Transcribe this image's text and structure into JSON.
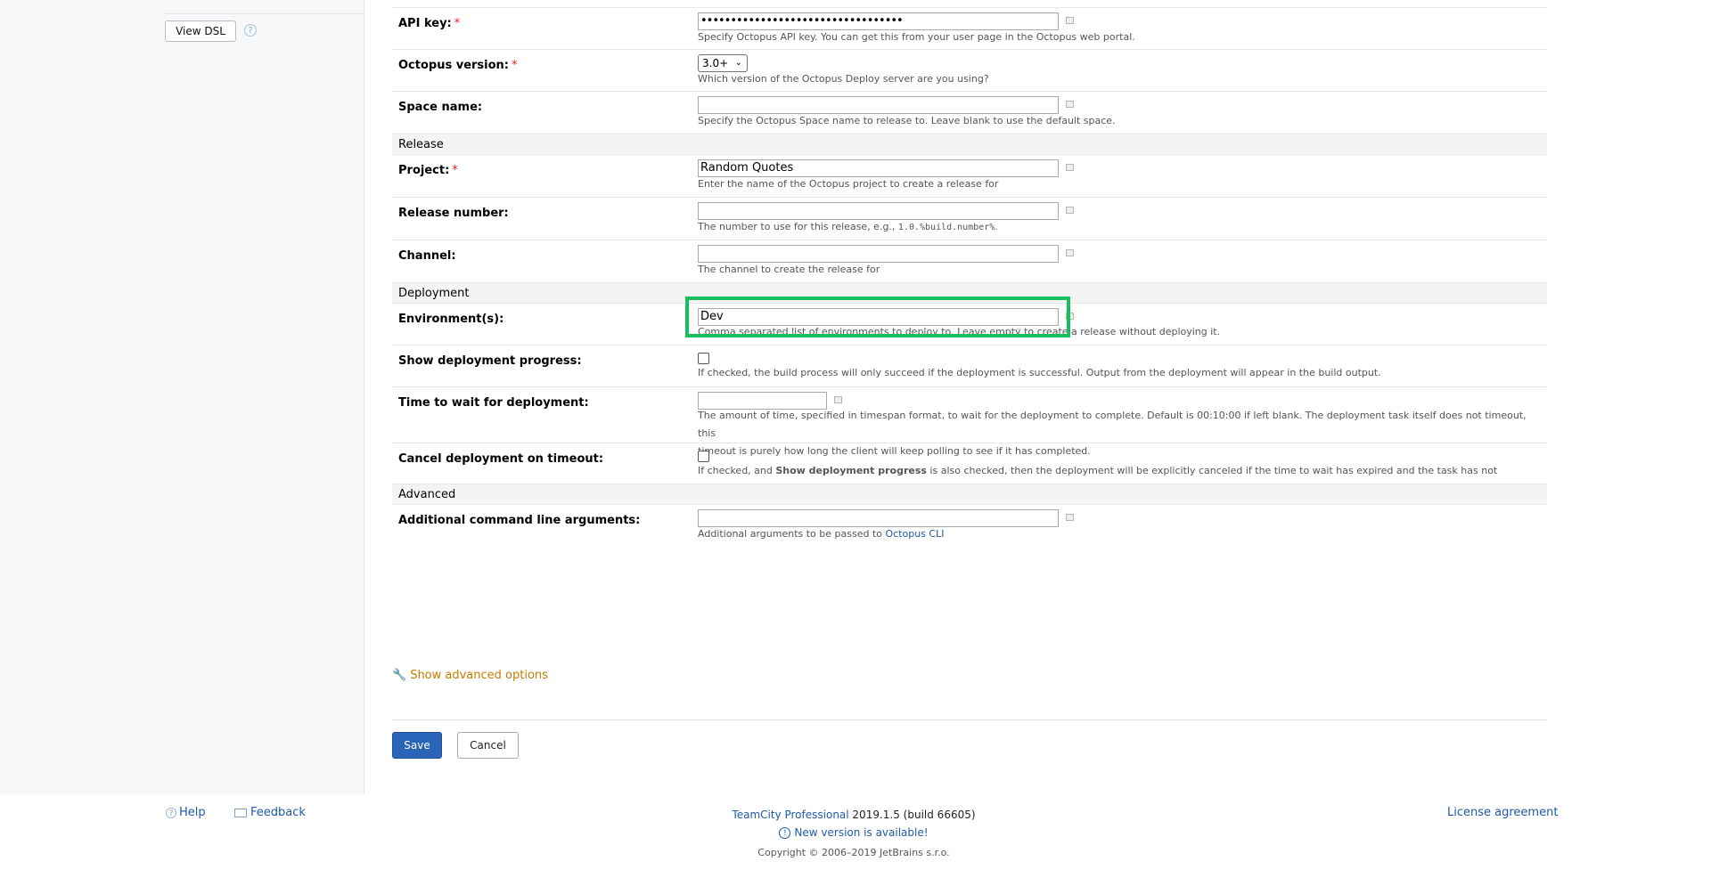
{
  "sidebar": {
    "view_dsl_label": "View DSL",
    "help_icon": "question-circle-icon"
  },
  "fields": {
    "api_key": {
      "label": "API key:",
      "value": "••••••••••••••••••••••••••••••••••",
      "note": "Specify Octopus API key. You can get this from your user page in the Octopus web portal."
    },
    "octopus_version": {
      "label": "Octopus version:",
      "value": "3.0+",
      "note": "Which version of the Octopus Deploy server are you using?"
    },
    "space_name": {
      "label": "Space name:",
      "value": "",
      "note": "Specify the Octopus Space name to release to. Leave blank to use the default space."
    },
    "project": {
      "label": "Project:",
      "value": "Random Quotes",
      "note": "Enter the name of the Octopus project to create a release for"
    },
    "release_number": {
      "label": "Release number:",
      "value": "",
      "note_prefix": "The number to use for this release, e.g., ",
      "note_code": "1.0.%build.number%",
      "note_suffix": "."
    },
    "channel": {
      "label": "Channel:",
      "value": "",
      "note": "The channel to create the release for"
    },
    "environments": {
      "label": "Environment(s):",
      "value": "Dev",
      "note": "Comma separated list of environments to deploy to. Leave empty to create a release without deploying it."
    },
    "show_progress": {
      "label": "Show deployment progress:",
      "checked": false,
      "note": "If checked, the build process will only succeed if the deployment is successful. Output from the deployment will appear in the build output."
    },
    "wait_time": {
      "label": "Time to wait for deployment:",
      "value": "",
      "note_line1": "The amount of time, specified in timespan format, to wait for the deployment to complete. Default is 00:10:00 if left blank. The deployment task itself does not timeout, this",
      "note_line2": "timeout is purely how long the client will keep polling to see if it has completed."
    },
    "cancel_on_timeout": {
      "label": "Cancel deployment on timeout:",
      "checked": false,
      "note_prefix": "If checked, and ",
      "note_bold": "Show deployment progress",
      "note_suffix": " is also checked, then the deployment will be explicitly canceled if the time to wait has expired and the task has not completed."
    },
    "additional_args": {
      "label": "Additional command line arguments:",
      "value": "",
      "note_prefix": "Additional arguments to be passed to ",
      "note_link": "Octopus CLI"
    }
  },
  "required_marker": "*",
  "sections": {
    "release": "Release",
    "deployment": "Deployment",
    "advanced": "Advanced"
  },
  "advanced_options_label": "Show advanced options",
  "buttons": {
    "save": "Save",
    "cancel": "Cancel"
  },
  "footer": {
    "help": "Help",
    "feedback": "Feedback",
    "product_link": "TeamCity Professional",
    "version": " 2019.1.5 (build 66605)",
    "new_version": "New version is available!",
    "copyright": "Copyright © 2006–2019 JetBrains s.r.o.",
    "license": "License agreement"
  },
  "colors": {
    "highlight": "#16c05a",
    "link": "#1e5aa8",
    "save_button": "#2a64b8",
    "advanced_link": "#c87b00"
  }
}
